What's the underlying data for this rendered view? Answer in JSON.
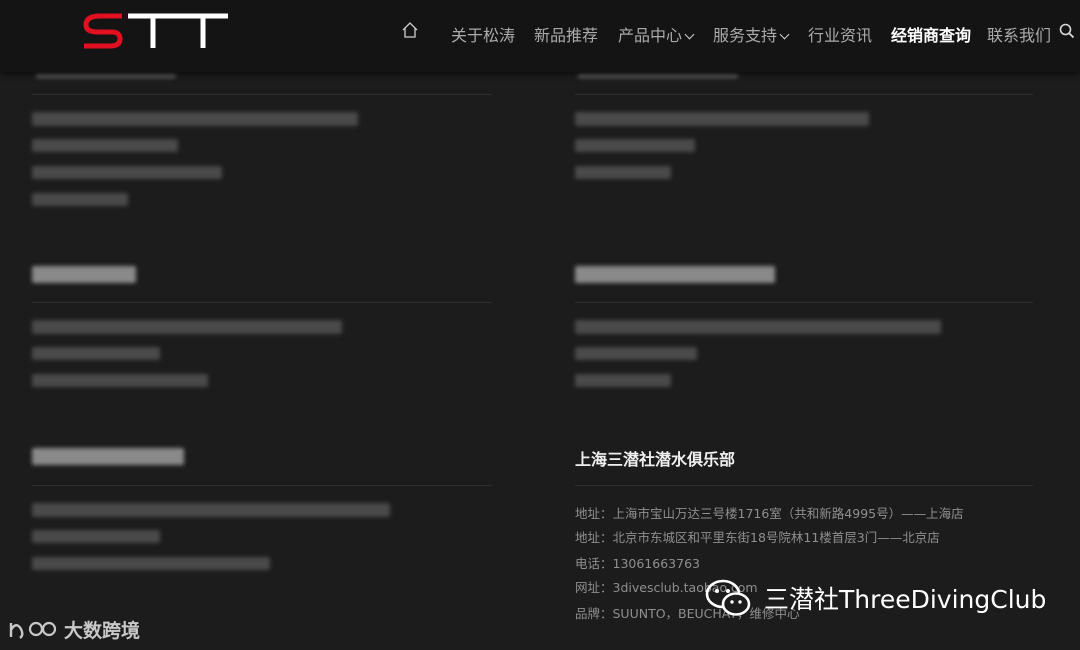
{
  "header": {
    "logo_text": "STT",
    "nav": [
      {
        "label": "关于松涛",
        "dropdown": false
      },
      {
        "label": "新品推荐",
        "dropdown": false
      },
      {
        "label": "产品中心",
        "dropdown": true
      },
      {
        "label": "服务支持",
        "dropdown": true
      },
      {
        "label": "行业资讯",
        "dropdown": false
      },
      {
        "label": "经销商查询",
        "dropdown": false,
        "active": true
      },
      {
        "label": "联系我们",
        "dropdown": false
      }
    ]
  },
  "dealer": {
    "name": "上海三潜社潜水俱乐部",
    "lines": [
      "地址：上海市宝山万达三号楼1716室（共和新路4995号）——上海店",
      "地址：北京市东城区和平里东街18号院林11楼首层3门——北京店",
      "电话：13061663763",
      "网址：3divesclub.taobao.com",
      "品牌：SUUNTO，BEUCHAT，维修中心"
    ]
  },
  "watermarks": {
    "left": "大数跨境",
    "right": "三潜社ThreeDivingClub"
  }
}
